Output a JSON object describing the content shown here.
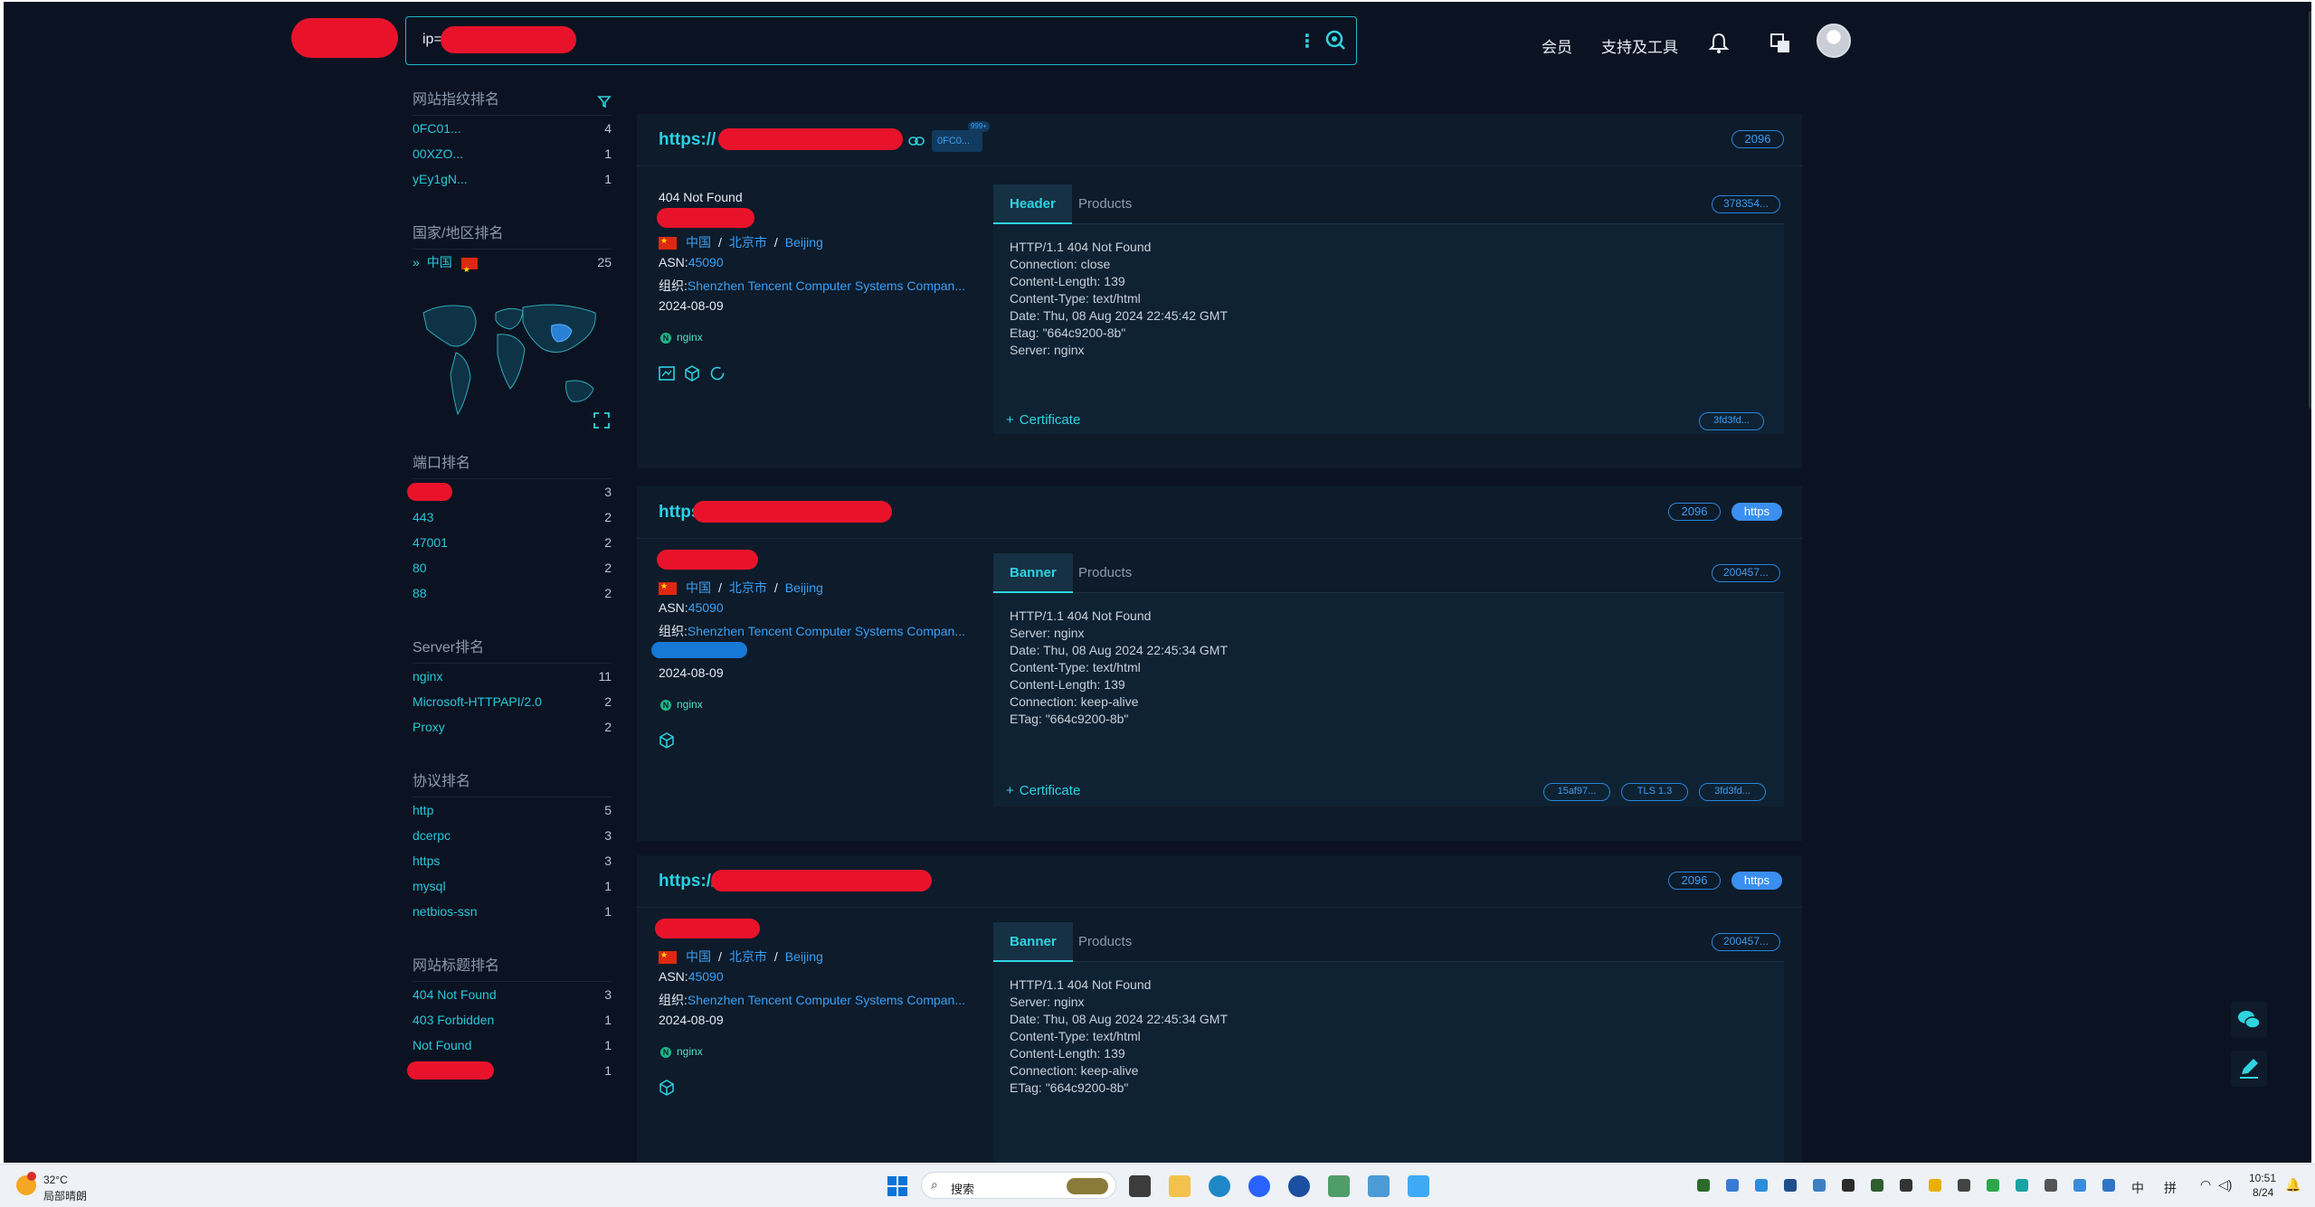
{
  "search": {
    "query": "ip=\""
  },
  "topnav": {
    "member": "会员",
    "tools": "支持及工具"
  },
  "sidebar": {
    "fingerprint": {
      "title": "网站指纹排名",
      "items": [
        {
          "label": "0FC01...",
          "count": "4"
        },
        {
          "label": "00XZO...",
          "count": "1"
        },
        {
          "label": "yEy1gN...",
          "count": "1"
        }
      ]
    },
    "country": {
      "title": "国家/地区排名",
      "items": [
        {
          "label": "中国",
          "count": "25"
        }
      ]
    },
    "port": {
      "title": "端口排名",
      "items": [
        {
          "label": "",
          "count": "3"
        },
        {
          "label": "443",
          "count": "2"
        },
        {
          "label": "47001",
          "count": "2"
        },
        {
          "label": "80",
          "count": "2"
        },
        {
          "label": "88",
          "count": "2"
        }
      ]
    },
    "server": {
      "title": "Server排名",
      "items": [
        {
          "label": "nginx",
          "count": "11"
        },
        {
          "label": "Microsoft-HTTPAPI/2.0",
          "count": "2"
        },
        {
          "label": "Proxy",
          "count": "2"
        }
      ]
    },
    "protocol": {
      "title": "协议排名",
      "items": [
        {
          "label": "http",
          "count": "5"
        },
        {
          "label": "dcerpc",
          "count": "3"
        },
        {
          "label": "https",
          "count": "3"
        },
        {
          "label": "mysql",
          "count": "1"
        },
        {
          "label": "netbios-ssn",
          "count": "1"
        }
      ]
    },
    "title_rank": {
      "title": "网站标题排名",
      "items": [
        {
          "label": "404 Not Found",
          "count": "3"
        },
        {
          "label": "403 Forbidden",
          "count": "1"
        },
        {
          "label": "Not Found",
          "count": "1"
        },
        {
          "label": "",
          "count": "1"
        }
      ]
    }
  },
  "results": [
    {
      "url": "https://",
      "fp_badge": "0FC0...",
      "fp_sup": "999+",
      "port": "2096",
      "title": "404 Not Found",
      "country": "中国",
      "city": "北京市",
      "region": "Beijing",
      "asn_label": "ASN:",
      "asn": "45090",
      "org_label": "组织:",
      "org": "Shenzhen Tencent Computer Systems Compan...",
      "date": "2024-08-09",
      "server_tag": "nginx",
      "tab_active": "Header",
      "tab2": "Products",
      "hash": "378354...",
      "lines": [
        "HTTP/1.1 404 Not Found",
        "Connection: close",
        "Content-Length: 139",
        "Content-Type: text/html",
        "Date: Thu, 08 Aug 2024 22:45:42 GMT",
        "Etag: \"664c9200-8b\"",
        "Server: nginx"
      ],
      "cert": "Certificate",
      "cert_tags": [
        "3fd3fd..."
      ]
    },
    {
      "url": "https",
      "port": "2096",
      "proto": "https",
      "country": "中国",
      "city": "北京市",
      "region": "Beijing",
      "asn_label": "ASN:",
      "asn": "45090",
      "org_label": "组织:",
      "org": "Shenzhen Tencent Computer Systems Compan...",
      "date": "2024-08-09",
      "server_tag": "nginx",
      "tab_active": "Banner",
      "tab2": "Products",
      "hash": "200457...",
      "lines": [
        "HTTP/1.1 404 Not Found",
        "Server: nginx",
        "Date: Thu, 08 Aug 2024 22:45:34 GMT",
        "Content-Type: text/html",
        "Content-Length: 139",
        "Connection: keep-alive",
        "ETag: \"664c9200-8b\""
      ],
      "cert": "Certificate",
      "cert_tags": [
        "15af97...",
        "TLS 1.3",
        "3fd3fd..."
      ]
    },
    {
      "url": "https://",
      "port": "2096",
      "proto": "https",
      "country": "中国",
      "city": "北京市",
      "region": "Beijing",
      "asn_label": "ASN:",
      "asn": "45090",
      "org_label": "组织:",
      "org": "Shenzhen Tencent Computer Systems Compan...",
      "date": "2024-08-09",
      "server_tag": "nginx",
      "tab_active": "Banner",
      "tab2": "Products",
      "hash": "200457...",
      "lines": [
        "HTTP/1.1 404 Not Found",
        "Server: nginx",
        "Date: Thu, 08 Aug 2024 22:45:34 GMT",
        "Content-Type: text/html",
        "Content-Length: 139",
        "Connection: keep-alive",
        "ETag: \"664c9200-8b\""
      ]
    }
  ],
  "taskbar": {
    "weather_temp": "32°C",
    "weather_desc": "局部晴朗",
    "search_placeholder": "搜索",
    "ime1": "中",
    "ime2": "拼",
    "time": "10:51",
    "date": "8/24"
  },
  "colors": {
    "bg": "#0b1322",
    "accent": "#2dd4e0",
    "link": "#3aa0f5",
    "redact": "#e8132b"
  }
}
